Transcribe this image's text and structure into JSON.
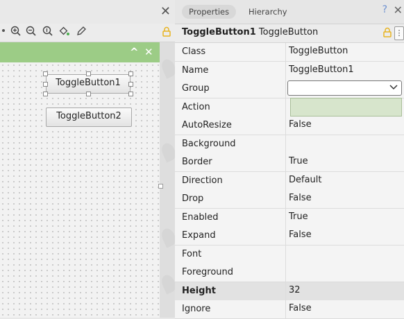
{
  "colors": {
    "form_header": "#9ccc86",
    "lock_icon": "#e8b320",
    "help_icon": "#6a8fd0",
    "dropdown_bg": "#d7e5cc"
  },
  "left": {
    "toolbar_icons": [
      "hand-icon",
      "zoom-in-icon",
      "zoom-out-icon",
      "zoom-reset-icon",
      "paint-icon",
      "pencil-icon"
    ],
    "close_glyph": "✕",
    "form_header_buttons": [
      "^",
      "✕"
    ],
    "buttons": [
      {
        "label": "ToggleButton1",
        "selected": true
      },
      {
        "label": "ToggleButton2",
        "selected": false
      }
    ]
  },
  "right": {
    "tabs": [
      {
        "label": "Properties",
        "active": true
      },
      {
        "label": "Hierarchy",
        "active": false
      }
    ],
    "help_glyph": "?",
    "close_glyph": "✕",
    "object_name": "ToggleButton1",
    "object_type": "ToggleButton",
    "properties": [
      {
        "name": "Class",
        "value": "ToggleButton"
      },
      {
        "name": "Name",
        "value": "ToggleButton1"
      },
      {
        "name": "Group",
        "value": ""
      },
      {
        "name": "Action",
        "value": ""
      },
      {
        "name": "AutoResize",
        "value": "False"
      },
      {
        "name": "Background",
        "value": ""
      },
      {
        "name": "Border",
        "value": "True"
      },
      {
        "name": "Direction",
        "value": "Default"
      },
      {
        "name": "Drop",
        "value": "False"
      },
      {
        "name": "Enabled",
        "value": "True"
      },
      {
        "name": "Expand",
        "value": "False"
      },
      {
        "name": "Font",
        "value": ""
      },
      {
        "name": "Foreground",
        "value": ""
      },
      {
        "name": "Height",
        "value": "32",
        "bold": true,
        "highlight": true
      },
      {
        "name": "Ignore",
        "value": "False"
      }
    ]
  }
}
